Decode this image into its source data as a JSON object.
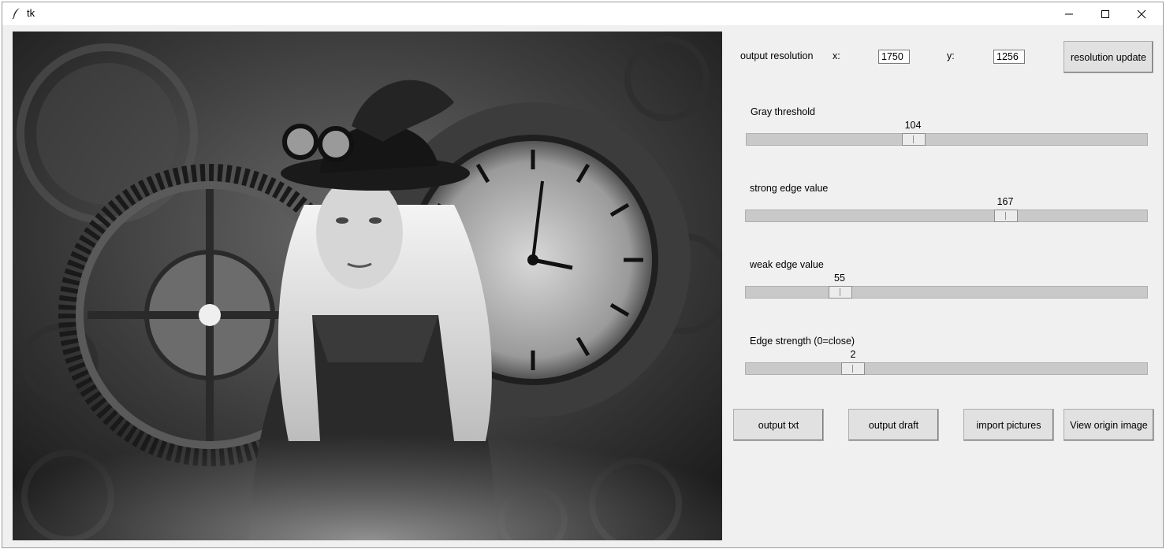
{
  "window": {
    "title": "tk"
  },
  "resolution": {
    "label": "output resolution",
    "x_label": "x:",
    "x_value": "1750",
    "y_label": "y:",
    "y_value": "1256",
    "update_button": "resolution update"
  },
  "sliders": [
    {
      "label": "Gray threshold",
      "value": 104
    },
    {
      "label": "strong edge value",
      "value": 167
    },
    {
      "label": "weak edge value",
      "value": 55
    },
    {
      "label": "Edge strength (0=close)",
      "value": 2
    }
  ],
  "buttons": {
    "output_txt": "output txt",
    "output_draft": "output draft",
    "import_pictures": "import pictures",
    "view_origin": "View origin image"
  }
}
